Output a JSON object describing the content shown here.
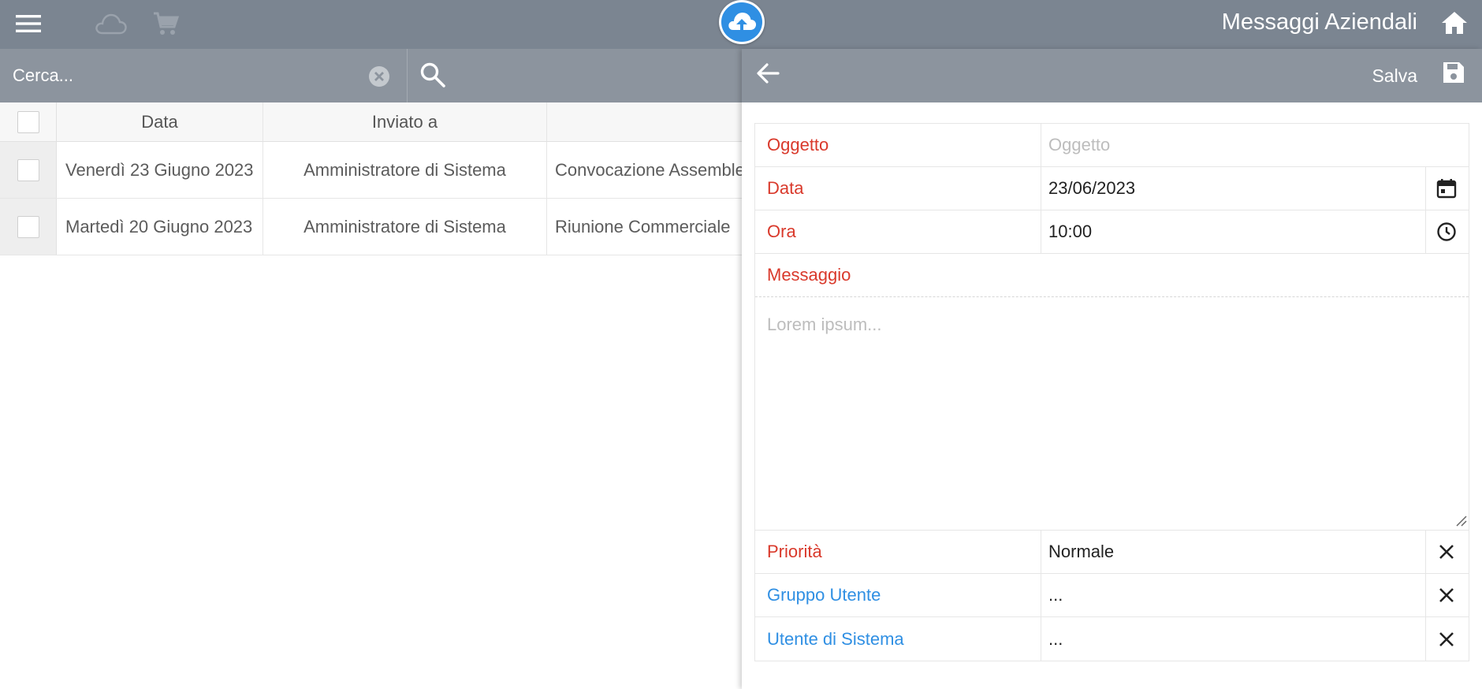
{
  "header": {
    "title": "Messaggi Aziendali",
    "icons": [
      "menu-icon",
      "cloud-icon",
      "cart-icon",
      "app-logo",
      "home-icon"
    ]
  },
  "list": {
    "search_placeholder": "Cerca...",
    "columns": [
      "Data",
      "Inviato a",
      ""
    ],
    "rows": [
      {
        "date": "Venerdì 23 Giugno 2023",
        "recipient": "Amministratore di Sistema",
        "subject": "Convocazione Assemble"
      },
      {
        "date": "Martedì 20 Giugno 2023",
        "recipient": "Amministratore di Sistema",
        "subject": "Riunione Commerciale"
      }
    ]
  },
  "editor": {
    "save_label": "Salva",
    "fields": {
      "oggetto": {
        "label": "Oggetto",
        "value": "",
        "placeholder": "Oggetto"
      },
      "data": {
        "label": "Data",
        "value": "23/06/2023"
      },
      "ora": {
        "label": "Ora",
        "value": "10:00"
      },
      "messaggio": {
        "label": "Messaggio",
        "value": "",
        "placeholder": "Lorem ipsum..."
      },
      "priorita": {
        "label": "Priorità",
        "value": "Normale"
      },
      "gruppo": {
        "label": "Gruppo Utente",
        "value": "..."
      },
      "utente": {
        "label": "Utente di Sistema",
        "value": "..."
      }
    }
  },
  "colors": {
    "topbar": "#7b8591",
    "subbar": "#8c949e",
    "required_label": "#d9392b",
    "optional_label": "#2f8fe3",
    "logo": "#2f8fe3"
  }
}
